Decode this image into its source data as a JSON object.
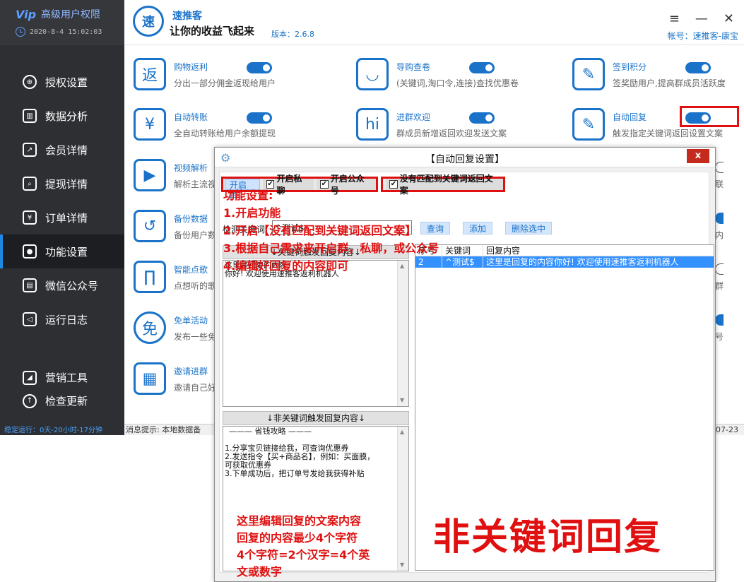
{
  "sidebar": {
    "brand": "高级用户权限",
    "logo_text": "Vip",
    "datetime": "2020-8-4 15:02:03",
    "nav": [
      {
        "label": "授权设置",
        "icon": "globe-icon"
      },
      {
        "label": "数据分析",
        "icon": "chart-icon"
      },
      {
        "label": "会员详情",
        "icon": "external-icon"
      },
      {
        "label": "提现详情",
        "icon": "search-icon"
      },
      {
        "label": "订单详情",
        "icon": "yen-doc-icon"
      },
      {
        "label": "功能设置",
        "icon": "chat-icon"
      },
      {
        "label": "微信公众号",
        "icon": "wechat-icon"
      },
      {
        "label": "运行日志",
        "icon": "speaker-icon"
      }
    ],
    "nav_bottom": [
      {
        "label": "营销工具",
        "icon": "marketing-icon"
      },
      {
        "label": "检查更新",
        "icon": "update-icon"
      }
    ],
    "uptime": "稳定运行：0天-20小时-17分钟"
  },
  "header": {
    "logo_char": "速",
    "app_name": "速推客",
    "slogan": "让你的收益飞起来",
    "version": "版本：2.6.8",
    "account": "帐号：速推客-康宝",
    "menu_icon": "≡",
    "min_icon": "—",
    "close_icon": "✕"
  },
  "features": [
    {
      "title": "购物返利",
      "desc": "分出一部分佣金返现给用户",
      "icon_char": "返",
      "enabled": true
    },
    {
      "title": "导购查卷",
      "desc": "(关键词,淘口令,连接)查找优惠卷",
      "icon_char": "◡",
      "enabled": true
    },
    {
      "title": "签到积分",
      "desc": "签奖励用户,提高群成员活跃度",
      "icon_char": "✎",
      "enabled": true
    },
    {
      "title": "自动转账",
      "desc": "全自动转账给用户余额提现",
      "icon_char": "¥",
      "enabled": true
    },
    {
      "title": "进群欢迎",
      "desc": "群成员新增返回欢迎发送文案",
      "icon_char": "hi",
      "enabled": true
    },
    {
      "title": "自动回复",
      "desc": "触发指定关键词返回设置文案",
      "icon_char": "✎",
      "enabled": true
    },
    {
      "title": "视频解析",
      "desc": "解析主流视",
      "icon_char": "▶",
      "enabled": true
    },
    {
      "title": "备份数据",
      "desc": "备份用户数",
      "icon_char": "↺",
      "enabled": true
    },
    {
      "title": "智能点歌",
      "desc": "点想听的歌",
      "icon_char": "∏",
      "enabled": true
    },
    {
      "title": "免单活动",
      "desc": "发布一些免",
      "icon_char": "免",
      "enabled": true
    },
    {
      "title": "邀请进群",
      "desc": "邀请自己好",
      "icon_char": "▦",
      "enabled": true
    }
  ],
  "right_fragments": [
    "联",
    "内",
    "群",
    "号"
  ],
  "statusbar": {
    "label": "消息提示:",
    "text": "本地数据备",
    "date": "07-23"
  },
  "dialog": {
    "title": "【自动回复设置】",
    "close_label": "x",
    "tab_group": "开启群",
    "chk_private": {
      "label": "开启私聊",
      "checked": true
    },
    "chk_public": {
      "label": "开启公众号",
      "checked": true
    },
    "chk_nomatch": {
      "label": "没有匹配到关键词返回文案",
      "checked": true
    },
    "keyword_label": "检测关键词:",
    "keyword_value": "^测试$",
    "btn_query": "查询",
    "btn_add": "添加",
    "btn_delete": "删除选中",
    "kw_panel_header": "↓关键词触发回复内容↓",
    "kw_panel_lines": [
      "这里是回复的内容",
      "你好! 欢迎使用速推客返利机器人"
    ],
    "nonkw_panel_header": "↓非关键词触发回复内容↓",
    "nonkw_panel_lines": [
      "——— 省钱攻略 ———",
      "",
      "1.分享宝贝链接给我，可查询优惠券",
      "2.发送指令【买+商品名】，例如：买面膜，",
      "可获取优惠券",
      "3.下单成功后，把订单号发给我获得补贴"
    ],
    "grid": {
      "headers": [
        "序号",
        "关键词",
        "回复内容"
      ],
      "rows": [
        [
          "2",
          "^测试$",
          "这里是回复的内容你好! 欢迎使用速推客返利机器人"
        ]
      ]
    }
  },
  "annotations": {
    "steps": [
      "功能设置:",
      "1.开启功能",
      "2.开启【没有匹配到关键词返回文案】",
      "3.根据自己需求来开启群，私聊，或公众号",
      "4.编辑好回复的内容即可"
    ],
    "hint": [
      "这里编辑回复的文案内容",
      "回复的内容最少4个字符",
      "4个字符=2个汉字=4个英",
      "文或数字"
    ],
    "big": "非关键词回复"
  },
  "colors": {
    "accent": "#1a73c8",
    "sidebar_bg": "#2d2f33",
    "highlight_red": "#e01010",
    "selection": "#3390ff"
  }
}
